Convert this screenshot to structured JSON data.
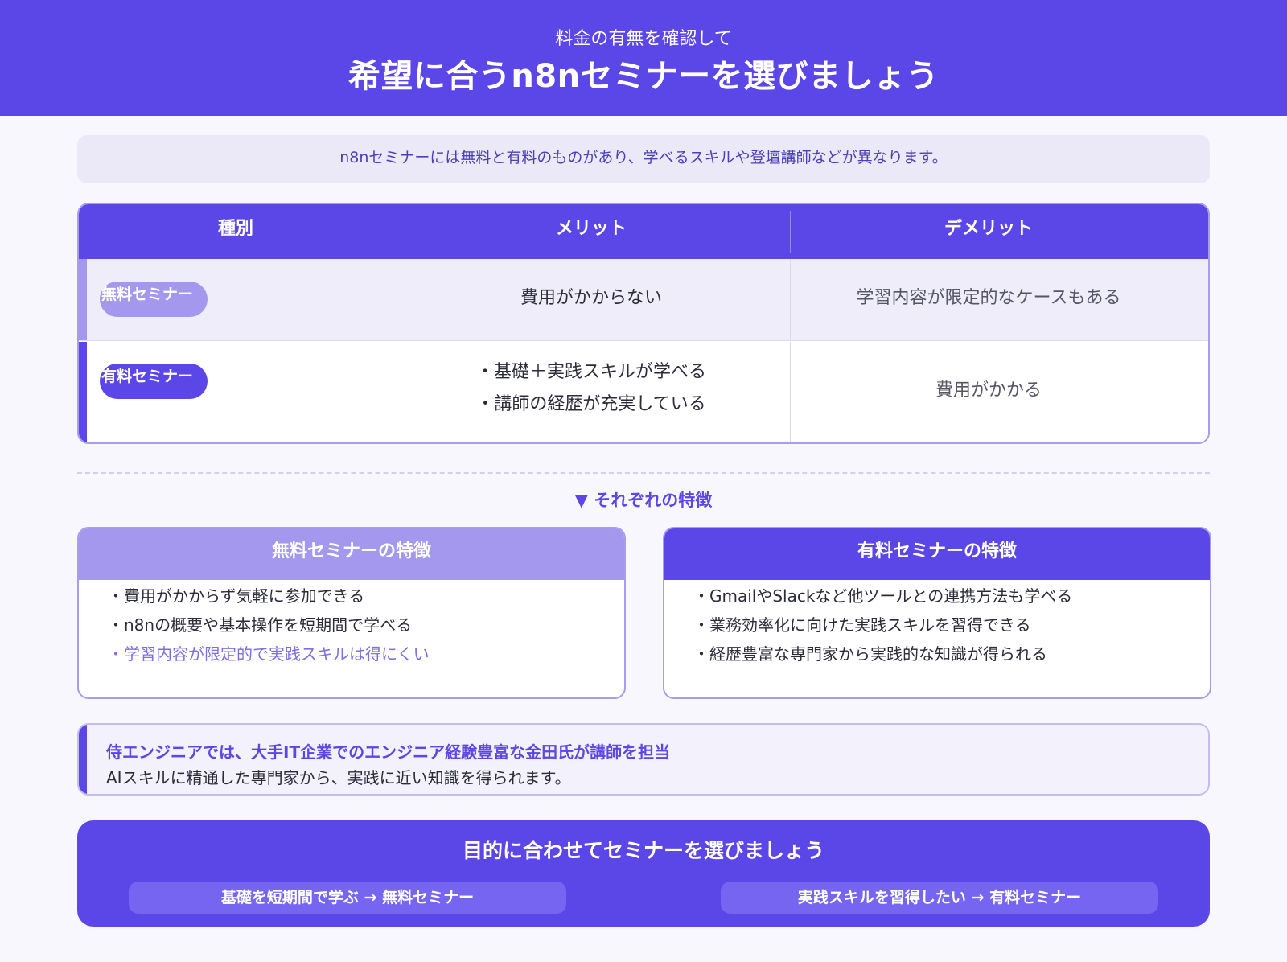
{
  "header": {
    "subtitle": "料金の有無を確認して",
    "title": "希望に合うn8nセミナーを選びましょう"
  },
  "intro": "n8nセミナーには無料と有料のものがあり、学べるスキルや登壇講師などが異なります。",
  "table": {
    "headers": [
      "種別",
      "メリット",
      "デメリット"
    ],
    "rows": [
      {
        "type": "無料セミナー",
        "merit": [
          "費用がかからない"
        ],
        "demerit": "学習内容が限定的なケースもある"
      },
      {
        "type": "有料セミナー",
        "merit": [
          "・基礎＋実践スキルが学べる",
          "・講師の経歴が充実している"
        ],
        "demerit": "費用がかかる"
      }
    ]
  },
  "section_label": "▼ それぞれの特徴",
  "cards": {
    "free": {
      "title": "無料セミナーの特徴",
      "items": [
        "・費用がかからず気軽に参加できる",
        "・n8nの概要や基本操作を短期間で学べる",
        "・学習内容が限定的で実践スキルは得にくい"
      ]
    },
    "paid": {
      "title": "有料セミナーの特徴",
      "items": [
        "・GmailやSlackなど他ツールとの連携方法も学べる",
        "・業務効率化に向けた実践スキルを習得できる",
        "・経歴豊富な専門家から実践的な知識が得られる"
      ]
    }
  },
  "note": {
    "headline": "侍エンジニアでは、大手IT企業でのエンジニア経験豊富な金田氏が講師を担当",
    "body": "AIスキルに精通した専門家から、実践に近い知識を得られます。"
  },
  "cta": {
    "title": "目的に合わせてセミナーを選びましょう",
    "options": [
      "基礎を短期間で学ぶ → 無料セミナー",
      "実践スキルを習得したい → 有料セミナー"
    ]
  },
  "colors": {
    "primary": "#5b46e8",
    "light": "#a397ee",
    "background": "#f8f7fd"
  }
}
